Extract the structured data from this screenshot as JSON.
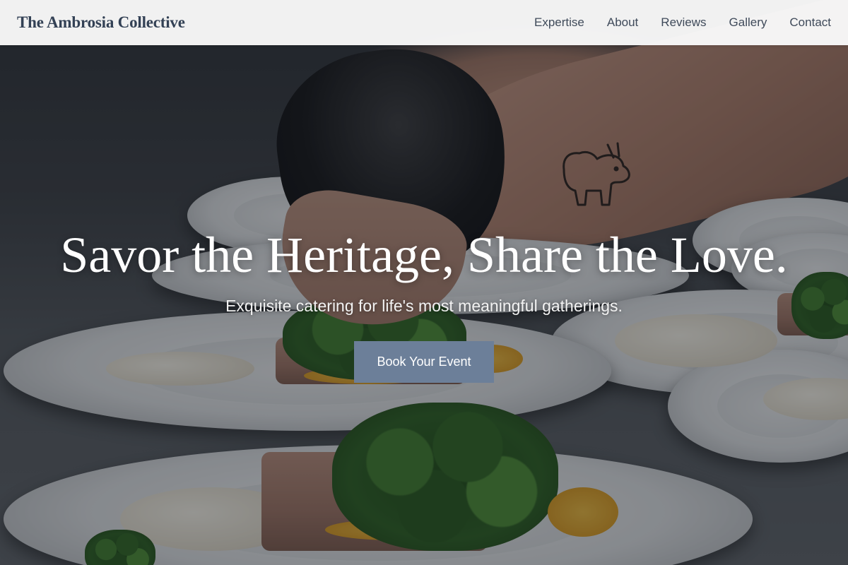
{
  "header": {
    "brand": "The Ambrosia Collective",
    "nav": [
      {
        "label": "Expertise"
      },
      {
        "label": "About"
      },
      {
        "label": "Reviews"
      },
      {
        "label": "Gallery"
      },
      {
        "label": "Contact"
      }
    ]
  },
  "hero": {
    "headline": "Savor the Heritage, Share the Love.",
    "subheadline": "Exquisite catering for life's most meaningful gatherings.",
    "cta_label": "Book Your Event",
    "cta_color": "#6c7f99"
  },
  "colors": {
    "header_bg": "#fafafa",
    "brand_text": "#334155",
    "nav_text": "#3f4a5a"
  }
}
